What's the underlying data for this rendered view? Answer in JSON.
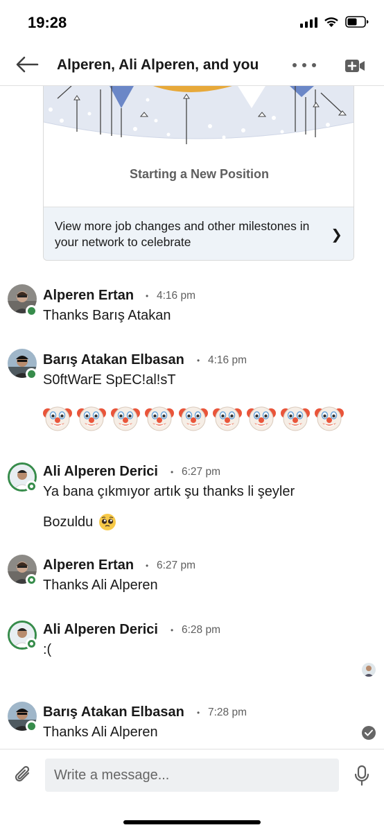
{
  "status_bar": {
    "time": "19:28",
    "icons": [
      "signal-icon",
      "wifi-icon",
      "battery-icon"
    ]
  },
  "header": {
    "title": "Alperen, Ali Alperen, and you",
    "icons": [
      "back-arrow-icon",
      "more-options-icon",
      "video-call-icon"
    ]
  },
  "card": {
    "title": "Starting a New Position",
    "footer_text": "View more job changes and other milestones in your network to celebrate",
    "chevron": "❯"
  },
  "messages": [
    {
      "sender": "Alperen Ertan",
      "time": "4:16 pm",
      "text": "Thanks Barış Atakan"
    },
    {
      "sender": "Barış Atakan Elbasan",
      "time": "4:16 pm",
      "text": "S0ftWarE SpEC!al!sT",
      "emoji_count": 9,
      "emoji": "clown-face"
    },
    {
      "sender": "Ali Alperen Derici",
      "time": "6:27 pm",
      "text": "Ya bana çıkmıyor artık şu thanks li şeyler",
      "text2": "Bozuldu",
      "emoji": "pleading-face"
    },
    {
      "sender": "Alperen Ertan",
      "time": "6:27 pm",
      "text": "Thanks Ali Alperen"
    },
    {
      "sender": "Ali Alperen Derici",
      "time": "6:28 pm",
      "text": ":("
    },
    {
      "sender": "Barış Atakan Elbasan",
      "time": "7:28 pm",
      "text": "Thanks Ali Alperen"
    }
  ],
  "composer": {
    "placeholder": "Write a message...",
    "icons": [
      "paperclip-icon",
      "microphone-icon"
    ]
  },
  "colors": {
    "presence_green": "#378c4b",
    "card_footer_bg": "#eef3f8",
    "input_bg": "#eef0f2"
  }
}
